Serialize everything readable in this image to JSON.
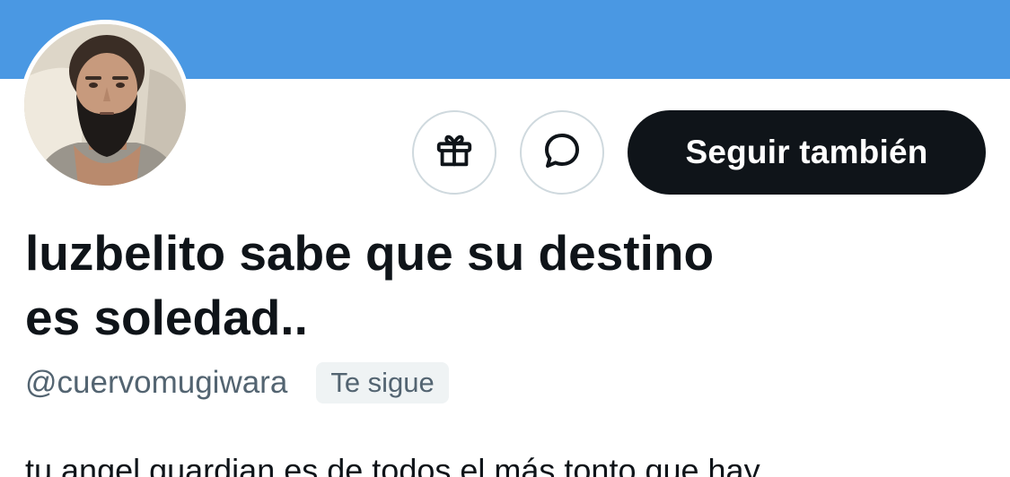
{
  "colors": {
    "banner": "#4a98e3",
    "primary_text": "#0f1419",
    "secondary_text": "#536471",
    "button_border": "#cfd9de",
    "badge_bg": "#eff3f4"
  },
  "profile": {
    "avatar_icon": "profile-photo",
    "display_name_line1": "luzbelito sabe que su destino",
    "display_name_line2": "es soledad..",
    "handle": "@cuervomugiwara",
    "follows_you_badge": "Te sigue",
    "bio": "tu angel guardian es de todos el más tonto que hay"
  },
  "actions": {
    "gift_icon": "gift-icon",
    "message_icon": "message-icon",
    "follow_label": "Seguir también"
  }
}
